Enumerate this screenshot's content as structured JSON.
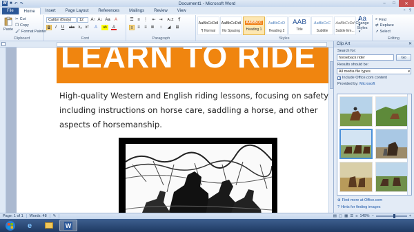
{
  "titlebar": {
    "title": "Document1 - Microsoft Word",
    "word_glyph": "W",
    "qat": [
      "save-icon",
      "undo-icon",
      "redo-icon"
    ]
  },
  "window_controls": {
    "minimize": "–",
    "maximize": "□",
    "close": "✕"
  },
  "tabs": [
    "File",
    "Home",
    "Insert",
    "Page Layout",
    "References",
    "Mailings",
    "Review",
    "View"
  ],
  "active_tab": "Home",
  "ribbon": {
    "clipboard": {
      "paste": "Paste",
      "cut": "Cut",
      "copy": "Copy",
      "format_painter": "Format Painter",
      "label": "Clipboard"
    },
    "font": {
      "family": "Calibri (Body)",
      "size": "12",
      "label": "Font",
      "bold": "B",
      "italic": "I",
      "underline": "U",
      "strike": "abc",
      "sub": "x₂",
      "sup": "x²",
      "grow": "A↑",
      "shrink": "A↓",
      "case": "Aa",
      "clear": "A",
      "highlight": "ab",
      "color": "A"
    },
    "paragraph": {
      "label": "Paragraph",
      "pilcrow": "¶",
      "sort": "A↓Z"
    },
    "styles": {
      "label": "Styles",
      "items": [
        {
          "sample": "AaBbCcDdI",
          "name": "¶ Normal"
        },
        {
          "sample": "AaBbCcDdI",
          "name": "No Spacing"
        },
        {
          "sample": "AABBCC",
          "name": "Heading 1"
        },
        {
          "sample": "AaBbCcD",
          "name": "Heading 2"
        },
        {
          "sample": "AAB",
          "name": "Title"
        },
        {
          "sample": "AaBbCcC",
          "name": "Subtitle"
        },
        {
          "sample": "AaBbCcDd",
          "name": "Subtle Em..."
        }
      ],
      "selected_index": 2,
      "change_styles": "Change Styles"
    },
    "editing": {
      "find": "Find",
      "replace": "Replace",
      "select": "Select",
      "label": "Editing"
    }
  },
  "document": {
    "banner_text": "LEARN TO RIDE",
    "lines": [
      "High-quality Western and English riding lessons, focusing on safety and",
      "including instructions on horse care, saddling a horse, and other",
      "aspects of horsemanship."
    ]
  },
  "clipart": {
    "title": "Clip Art",
    "close": "✕",
    "search_label": "Search for:",
    "search_value": "horseback rider",
    "go": "Go",
    "results_label": "Results should be:",
    "results_value": "All media file types",
    "include_office": "Include Office.com content",
    "provided_by_label": "Provided by:",
    "provided_by_value": "Microsoft",
    "find_more": "Find more at Office.com",
    "hints": "Hints for finding images"
  },
  "status": {
    "page": "Page: 1 of 1",
    "words": "Words: 48",
    "zoom": "149%",
    "zoom_level": 0.55
  },
  "colors": {
    "banner": "#f0850f",
    "accent": "#2b5797"
  }
}
